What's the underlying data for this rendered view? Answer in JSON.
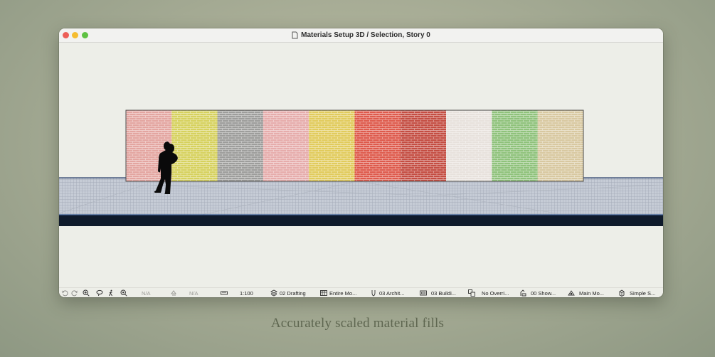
{
  "window": {
    "title": "Materials Setup 3D / Selection, Story 0"
  },
  "materials": [
    {
      "name": "pink-brick",
      "color": "#e3a5a0"
    },
    {
      "name": "yellow-brick",
      "color": "#d6d15e"
    },
    {
      "name": "gray-brick",
      "color": "#9d9d9b"
    },
    {
      "name": "light-pink-brick",
      "color": "#e6acab"
    },
    {
      "name": "gold-brick",
      "color": "#e1cb5c"
    },
    {
      "name": "red-brick",
      "color": "#de5a4c"
    },
    {
      "name": "dark-red-brick",
      "color": "#c44d42"
    },
    {
      "name": "white-brick",
      "color": "#e7e1dc"
    },
    {
      "name": "green-brick",
      "color": "#8fc27b"
    },
    {
      "name": "tan-brick",
      "color": "#d8c8a0"
    }
  ],
  "statusbar": {
    "zoom_na": "N/A",
    "orbit_na": "N/A",
    "scale": "1:100",
    "layer_combination": "02 Drafting",
    "model_view": "Entire Mo...",
    "pen_set": "03 Archit...",
    "structural": "03 Buildi...",
    "graphic_override": "No Overri...",
    "renovation": "00 Show...",
    "dimension": "Main Mo...",
    "partial_structure": "Simple S..."
  },
  "caption": "Accurately scaled material fills"
}
